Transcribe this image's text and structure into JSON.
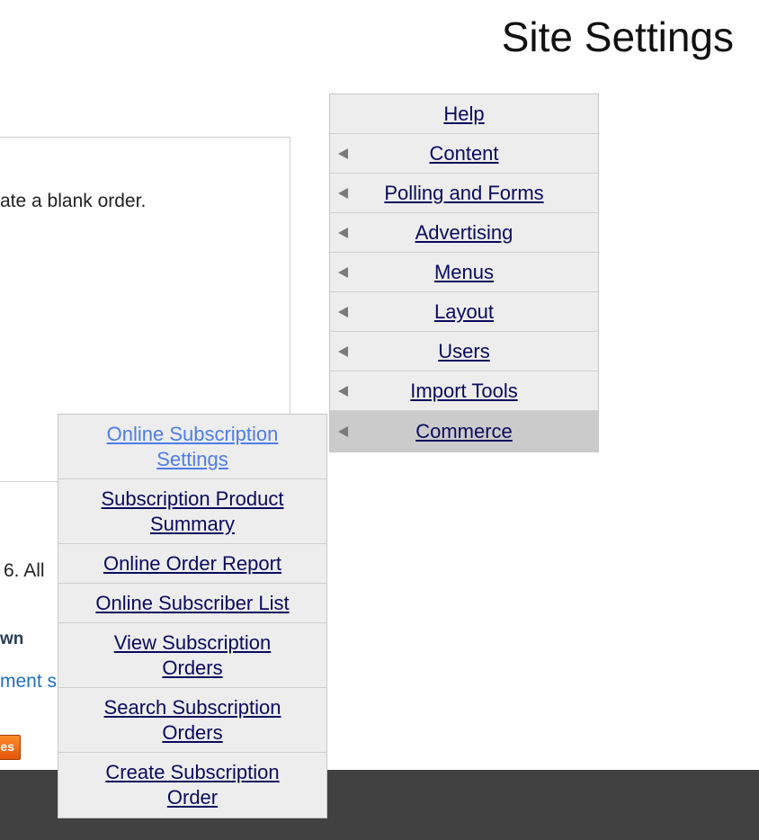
{
  "header": {
    "title": "Site Settings"
  },
  "main_content": {
    "text": "ate a blank order."
  },
  "background": {
    "copyright_fragment": "6. All",
    "powered_fragment": "wn",
    "link_fragment": "ment s",
    "button_fragment": "es"
  },
  "main_menu": {
    "items": [
      {
        "label": "Help",
        "has_arrow": false
      },
      {
        "label": "Content",
        "has_arrow": true
      },
      {
        "label": "Polling and Forms",
        "has_arrow": true
      },
      {
        "label": "Advertising",
        "has_arrow": true
      },
      {
        "label": "Menus",
        "has_arrow": true
      },
      {
        "label": "Layout",
        "has_arrow": true
      },
      {
        "label": "Users",
        "has_arrow": true
      },
      {
        "label": "Import Tools",
        "has_arrow": true
      },
      {
        "label": "Commerce",
        "has_arrow": true,
        "active": true
      }
    ]
  },
  "commerce_submenu": {
    "items": [
      {
        "label": "Online Subscription Settings"
      },
      {
        "label": "Subscription Product Summary"
      },
      {
        "label": "Online Order Report"
      },
      {
        "label": "Online Subscriber List"
      },
      {
        "label": "View Subscription Orders"
      },
      {
        "label": "Search Subscription Orders"
      },
      {
        "label": "Create Subscription Order"
      }
    ]
  },
  "colors": {
    "menu_background": "#ededed",
    "menu_active_background": "#cbcbcb",
    "link_color": "#0a0a5e",
    "hover_link_color": "#4f7de8",
    "footer_background": "#414141",
    "accent_orange": "#e2560a"
  }
}
